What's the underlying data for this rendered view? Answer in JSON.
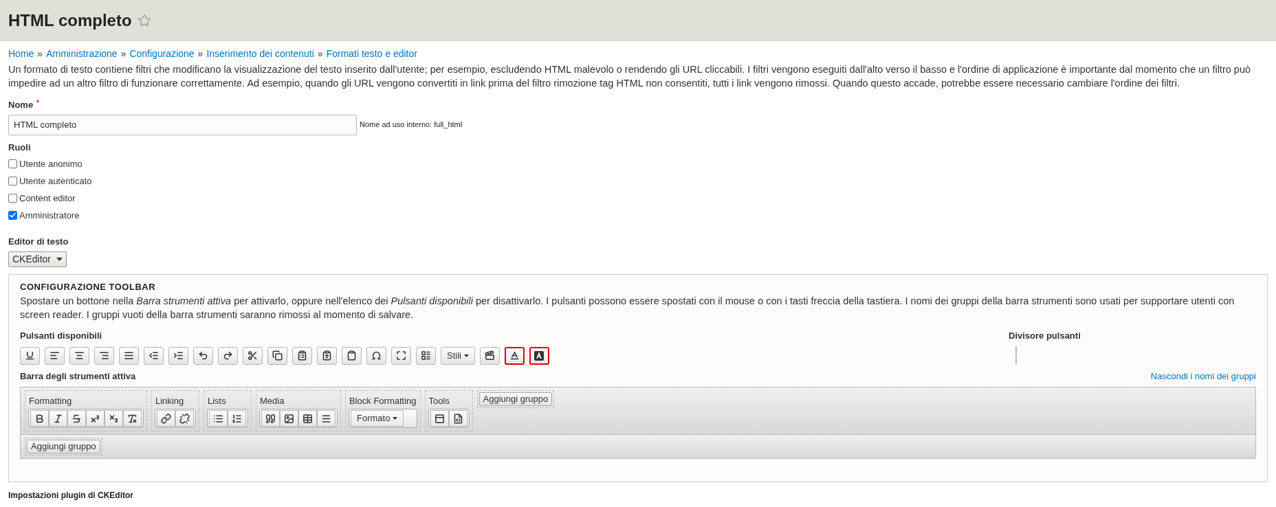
{
  "page_title": "HTML completo",
  "favorite": {
    "selected": false
  },
  "breadcrumb": [
    "Home",
    "Amministrazione",
    "Configurazione",
    "Inserimento dei contenuti",
    "Formati testo e editor"
  ],
  "breadcrumb_separator": "»",
  "description": "Un formato di testo contiene filtri che modificano la visualizzazione del testo inserito dall'utente; per esempio, escludendo HTML malevolo o rendendo gli URL cliccabili. I filtri vengono eseguiti dall'alto verso il basso e l'ordine di applicazione è importante dal momento che un filtro può impedire ad un altro filtro di funzionare correttamente. Ad esempio, quando gli URL vengono convertiti in link prima del filtro rimozione tag HTML non consentiti, tutti i link vengono rimossi. Quando questo accade, potrebbe essere necessario cambiare l'ordine dei filtri.",
  "name_field": {
    "label": "Nome",
    "required_mark": "*",
    "value": "HTML completo",
    "machine_name": "Nome ad uso interno: full_html"
  },
  "roles": {
    "label": "Ruoli",
    "items": [
      {
        "label": "Utente anonimo",
        "checked": false
      },
      {
        "label": "Utente autenticato",
        "checked": false
      },
      {
        "label": "Content editor",
        "checked": false
      },
      {
        "label": "Amministratore",
        "checked": true
      }
    ]
  },
  "editor": {
    "label": "Editor di testo",
    "value": "CKEditor"
  },
  "toolbar_config": {
    "title": "CONFIGURAZIONE TOOLBAR",
    "help": "Spostare un bottone nella *Barra strumenti attiva* per attivarlo, oppure nell'elenco dei *Pulsanti disponibili* per disattivarlo. I pulsanti possono essere spostati con il mouse o con i tasti freccia della tastiera. I nomi dei gruppi della barra strumenti sono usati per supportare utenti con screen reader. I gruppi vuoti della barra strumenti saranno rimossi al momento di salvare.",
    "available_label": "Pulsanti disponibili",
    "available_buttons": [
      {
        "kind": "icon",
        "highlighted": false
      },
      {
        "kind": "icon",
        "highlighted": false
      },
      {
        "kind": "icon",
        "highlighted": false
      },
      {
        "kind": "icon",
        "highlighted": false
      },
      {
        "kind": "icon",
        "highlighted": false
      },
      {
        "kind": "icon",
        "highlighted": false
      },
      {
        "kind": "icon",
        "highlighted": false
      },
      {
        "kind": "icon",
        "highlighted": false
      },
      {
        "kind": "icon",
        "highlighted": false
      },
      {
        "kind": "icon",
        "highlighted": false
      },
      {
        "kind": "icon",
        "highlighted": false
      },
      {
        "kind": "icon",
        "highlighted": false
      },
      {
        "kind": "icon",
        "highlighted": false
      },
      {
        "kind": "icon",
        "highlighted": false
      },
      {
        "kind": "icon",
        "highlighted": false
      },
      {
        "kind": "icon",
        "highlighted": false
      },
      {
        "kind": "icon",
        "highlighted": false
      },
      {
        "kind": "menu",
        "label": "Stili",
        "highlighted": false
      },
      {
        "kind": "icon",
        "highlighted": false
      },
      {
        "kind": "icon",
        "highlighted": true
      },
      {
        "kind": "icon",
        "highlighted": true
      }
    ],
    "divider_label": "Divisore pulsanti",
    "active_label": "Barra degli strumenti attiva",
    "toggle_link": "Nascondi i nomi dei gruppi",
    "rows": [
      {
        "groups": [
          {
            "name": "Formatting",
            "buttons": [
              {
                "kind": "icon"
              },
              {
                "kind": "icon"
              },
              {
                "kind": "icon"
              },
              {
                "kind": "icon"
              },
              {
                "kind": "icon"
              },
              {
                "kind": "icon"
              }
            ]
          },
          {
            "name": "Linking",
            "buttons": [
              {
                "kind": "icon"
              },
              {
                "kind": "icon"
              }
            ]
          },
          {
            "name": "Lists",
            "buttons": [
              {
                "kind": "icon"
              },
              {
                "kind": "icon"
              }
            ]
          },
          {
            "name": "Media",
            "buttons": [
              {
                "kind": "icon"
              },
              {
                "kind": "icon"
              },
              {
                "kind": "icon"
              },
              {
                "kind": "icon"
              }
            ]
          },
          {
            "name": "Block Formatting",
            "buttons": [
              {
                "kind": "menu",
                "label": "Formato"
              }
            ]
          },
          {
            "name": "Tools",
            "buttons": [
              {
                "kind": "icon"
              },
              {
                "kind": "icon"
              }
            ]
          }
        ],
        "add_group": "Aggiungi gruppo"
      },
      {
        "groups": [],
        "add_group": "Aggiungi gruppo"
      }
    ]
  },
  "plugin_settings_title": "Impostazioni plugin di CKEditor"
}
